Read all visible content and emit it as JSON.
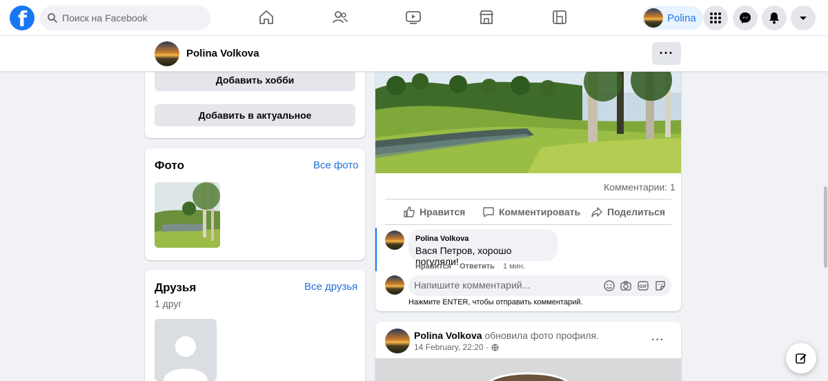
{
  "nav": {
    "logo_letter": "f",
    "search_placeholder": "Поиск на Facebook",
    "icons": [
      "home-icon",
      "friends-icon",
      "watch-icon",
      "marketplace-icon",
      "groups-icon"
    ],
    "user_name": "Polina",
    "right_icons": [
      "menu-grid-icon",
      "messenger-icon",
      "notifications-icon",
      "account-caret-icon"
    ]
  },
  "profile_bar": {
    "name": "Polina Volkova",
    "more_label": "···"
  },
  "intro": {
    "add_hobbies": "Добавить хобби",
    "add_featured": "Добавить в актуальное"
  },
  "photos": {
    "title": "Фото",
    "see_all": "Все фото"
  },
  "friends": {
    "title": "Друзья",
    "see_all": "Все друзья",
    "count": "1 друг"
  },
  "post1": {
    "comments_count": "Комментарии: 1",
    "actions": {
      "like": "Нравится",
      "comment": "Комментировать",
      "share": "Поделиться"
    },
    "comment": {
      "author": "Polina Volkova",
      "text": "Вася Петров, хорошо погуляли!",
      "like": "Нравится",
      "reply": "Ответить",
      "time": "1 мин."
    },
    "composer_placeholder": "Напишите комментарий...",
    "composer_hint": "Нажмите ENTER, чтобы отправить комментарий."
  },
  "post2": {
    "author": "Polina Volkova",
    "action": "обновила фото профиля.",
    "date": "14 February, 22:20 ·",
    "more_label": "···"
  },
  "colors": {
    "brand": "#1877f2",
    "link": "#216fdb",
    "background": "#f0f2f5"
  }
}
